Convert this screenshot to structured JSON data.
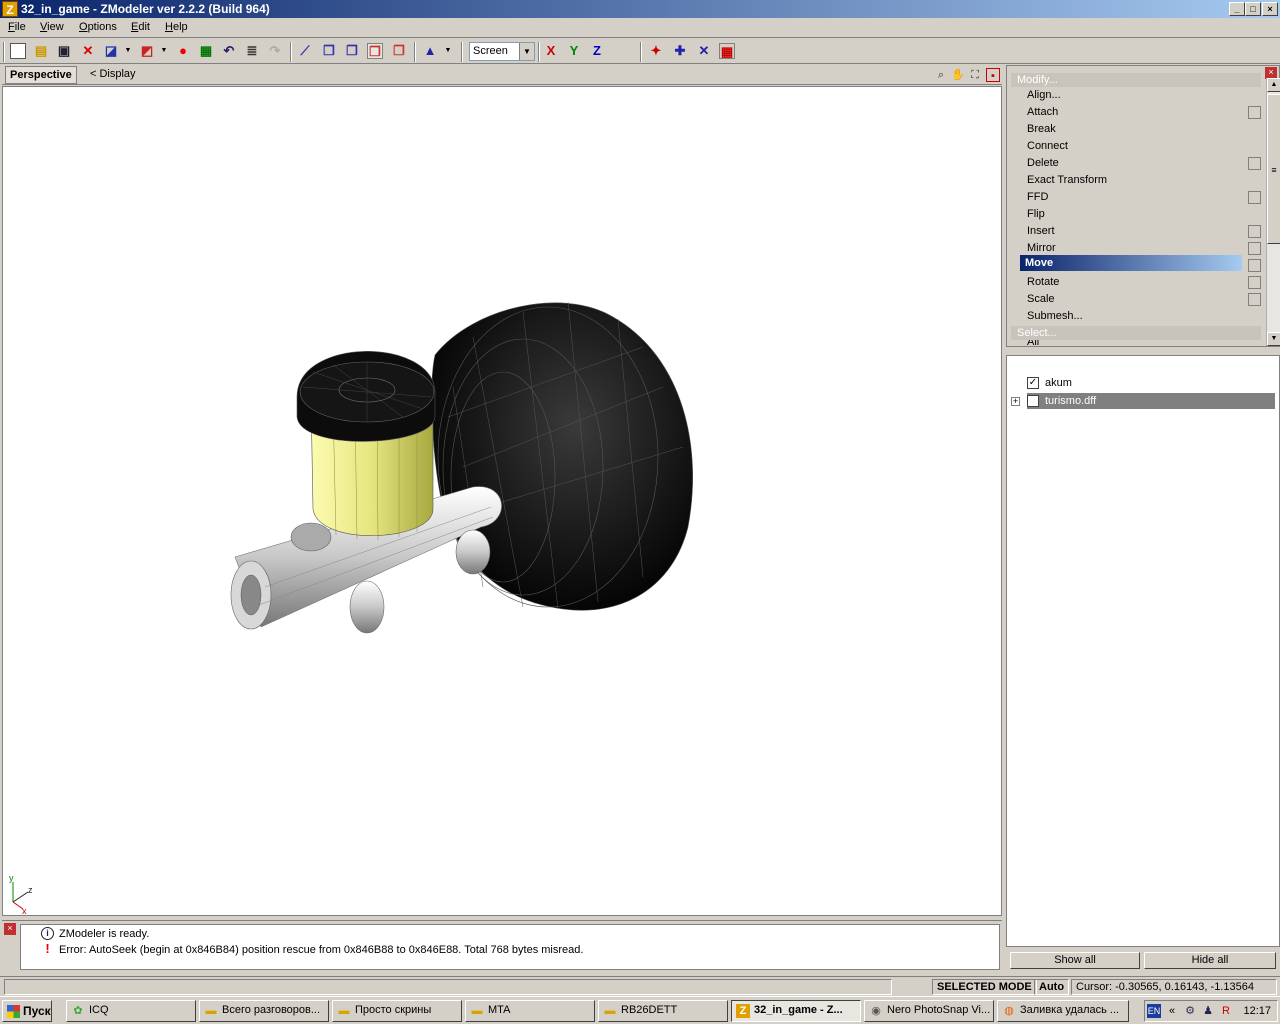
{
  "window": {
    "title": "32_in_game - ZModeler ver 2.2.2 (Build 964)",
    "app_icon": "Z",
    "controls": [
      "_",
      "□",
      "×"
    ]
  },
  "menu": [
    "File",
    "View",
    "Options",
    "Edit",
    "Help"
  ],
  "toolbar": {
    "icons": [
      "new-icon",
      "open-icon",
      "save-icon",
      "delete-icon",
      "import-icon",
      "export-icon",
      "record-icon",
      "render-icon",
      "undo-icon",
      "properties-icon",
      "redo-icon",
      "vertex-mode-icon",
      "box-mode-icon",
      "box2-mode-icon",
      "box3-mode-icon",
      "box4-mode-icon",
      "axis-icon"
    ],
    "coord_system": "Screen",
    "axes": {
      "x": "X",
      "y": "Y",
      "z": "Z"
    },
    "axis_colors": {
      "x": "#cc0000",
      "y": "#008800",
      "z": "#0000cc"
    }
  },
  "viewport": {
    "tab": "Perspective",
    "display": "<  Display",
    "axis_labels": {
      "y": "y",
      "z": "z",
      "x": "x"
    }
  },
  "console": {
    "messages": [
      {
        "type": "info",
        "text": "ZModeler is ready."
      },
      {
        "type": "error",
        "text": "Error: AutoSeek (begin at 0x846B84) position rescue  from 0x846B88 to 0x846E88. Total 768 bytes misread."
      }
    ]
  },
  "modify_panel": {
    "group_top": "Modify...",
    "items": [
      "Align...",
      "Attach",
      "Break",
      "Connect",
      "Delete",
      "Exact Transform",
      "FFD",
      "Flip",
      "Insert",
      "Mirror",
      "Move",
      "Rotate",
      "Scale",
      "Submesh..."
    ],
    "selected": "Move",
    "group_bottom": "Select...",
    "group_bottom_next": "All"
  },
  "objects": [
    {
      "name": "akum",
      "checked": true
    },
    {
      "name": "turismo.dff",
      "checked": false
    }
  ],
  "object_buttons": {
    "show_all": "Show all",
    "hide_all": "Hide all"
  },
  "status": {
    "mode": "SELECTED MODE",
    "auto": "Auto",
    "cursor": "Cursor: -0.30565, 0.16143, -1.13564"
  },
  "taskbar": {
    "start": "Пуск",
    "tasks": [
      {
        "label": "ICQ",
        "icon": "flower-icon"
      },
      {
        "label": "Всего разговоров...",
        "icon": "folder-icon"
      },
      {
        "label": "Просто скрины",
        "icon": "folder-icon"
      },
      {
        "label": "MTA",
        "icon": "folder-icon"
      },
      {
        "label": "RB26DETT",
        "icon": "folder-icon"
      },
      {
        "label": "32_in_game - Z...",
        "icon": "zmodeler-icon",
        "active": true
      },
      {
        "label": "Nero PhotoSnap Vi...",
        "icon": "nero-icon"
      },
      {
        "label": "Заливка удалась ...",
        "icon": "firefox-icon"
      }
    ],
    "lang": "EN",
    "clock": "12:17"
  }
}
